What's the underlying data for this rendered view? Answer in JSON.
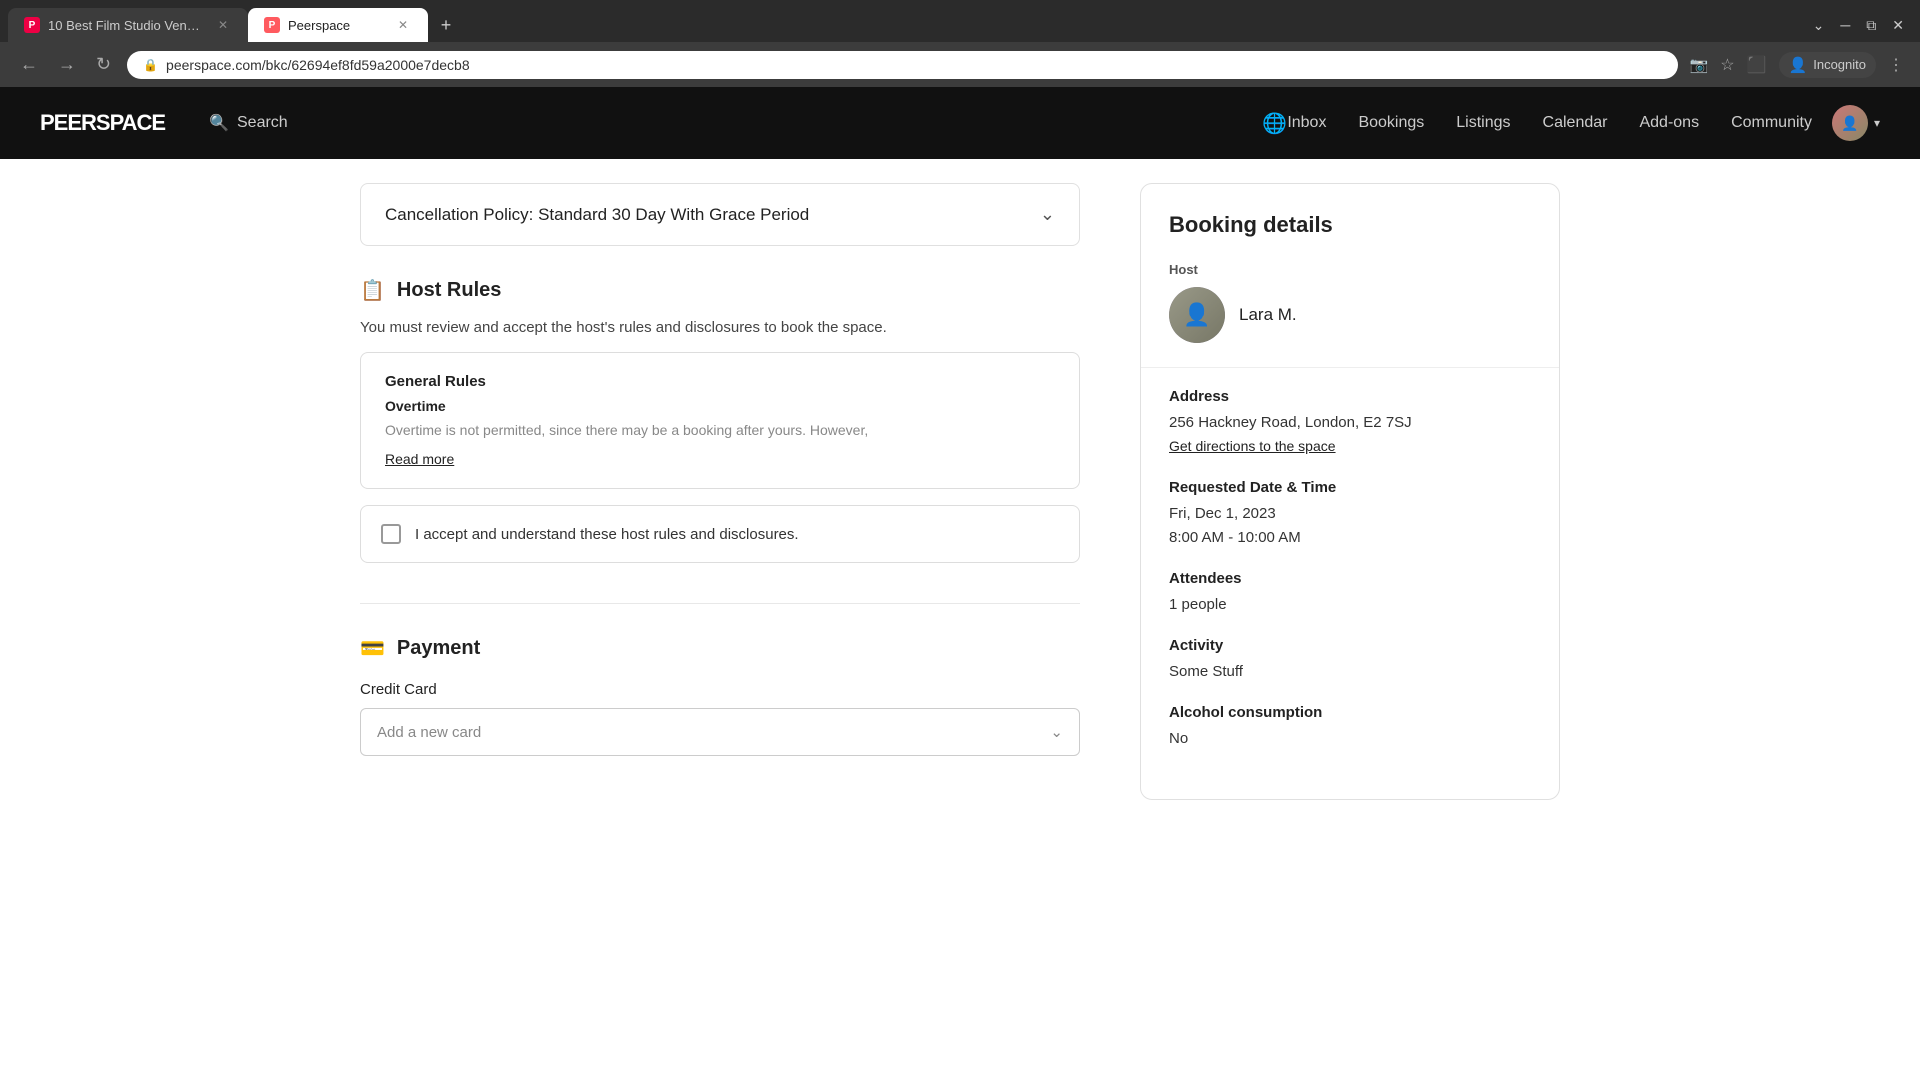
{
  "browser": {
    "tabs": [
      {
        "id": "tab1",
        "title": "10 Best Film Studio Venues - Lo...",
        "active": false,
        "favicon": "P"
      },
      {
        "id": "tab2",
        "title": "Peerspace",
        "active": true,
        "favicon": "P"
      }
    ],
    "url": "peerspace.com/bkc/62694ef8fd59a2000e7decb8",
    "profile": "Incognito"
  },
  "nav": {
    "logo": "PEERSPACE",
    "search_label": "Search",
    "links": [
      "Inbox",
      "Bookings",
      "Listings",
      "Calendar",
      "Add-ons",
      "Community"
    ]
  },
  "cancellation_policy": {
    "title": "Cancellation Policy: Standard 30 Day With Grace Period"
  },
  "host_rules": {
    "section_title": "Host Rules",
    "subtitle": "You must review and accept the host's rules and disclosures to book the space.",
    "general_rules_title": "General Rules",
    "overtime_title": "Overtime",
    "overtime_text": "Overtime is not permitted, since there may be a booking after yours. However,",
    "read_more": "Read more",
    "accept_text": "I accept and understand these host rules and disclosures."
  },
  "payment": {
    "section_title": "Payment",
    "credit_card_label": "Credit Card",
    "add_card_placeholder": "Add a new card"
  },
  "booking_details": {
    "title": "Booking details",
    "host_label": "Host",
    "host_name": "Lara M.",
    "address_label": "Address",
    "address_line1": "256 Hackney Road, London, E2 7SJ",
    "get_directions": "Get directions to the space",
    "requested_datetime_label": "Requested Date & Time",
    "date_line1": "Fri, Dec 1, 2023",
    "time_line": "8:00 AM - 10:00 AM",
    "attendees_label": "Attendees",
    "attendees_value": "1 people",
    "activity_label": "Activity",
    "activity_value": "Some Stuff",
    "alcohol_label": "Alcohol consumption",
    "alcohol_value": "No"
  }
}
